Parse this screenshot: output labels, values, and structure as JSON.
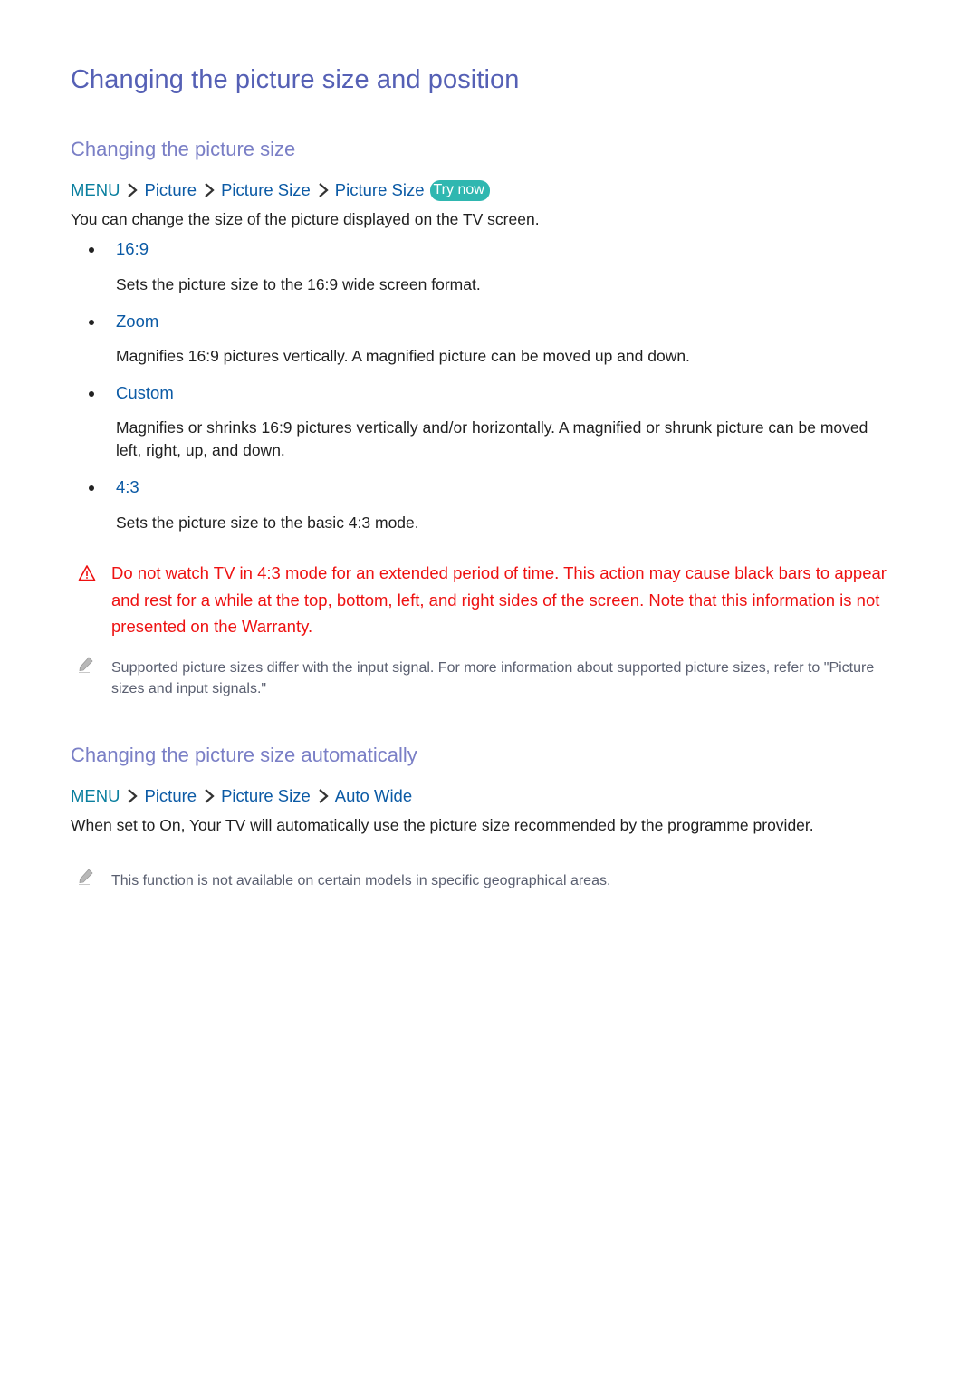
{
  "title": "Changing the picture size and position",
  "section1": {
    "heading": "Changing the picture size",
    "breadcrumb": {
      "menu": "MENU",
      "items": [
        "Picture",
        "Picture Size",
        "Picture Size"
      ],
      "try_now": "Try now"
    },
    "intro": "You can change the size of the picture displayed on the TV screen.",
    "options": [
      {
        "label": "16:9",
        "description": "Sets the picture size to the 16:9 wide screen format."
      },
      {
        "label": "Zoom",
        "description": "Magnifies 16:9 pictures vertically. A magnified picture can be moved up and down."
      },
      {
        "label": "Custom",
        "description": "Magnifies or shrinks 16:9 pictures vertically and/or horizontally. A magnified or shrunk picture can be moved left, right, up, and down."
      },
      {
        "label": "4:3",
        "description": "Sets the picture size to the basic 4:3 mode."
      }
    ],
    "warning": {
      "icon": "warning-triangle-icon",
      "text": "Do not watch TV in 4:3 mode for an extended period of time. This action may cause black bars to appear and rest for a while at the top, bottom, left, and right sides of the screen. Note that this information is not presented on the Warranty."
    },
    "note": {
      "icon": "pencil-note-icon",
      "text": "Supported picture sizes differ with the input signal. For more information about supported picture sizes, refer to \"Picture sizes and input signals.\""
    }
  },
  "section2": {
    "heading": "Changing the picture size automatically",
    "breadcrumb": {
      "menu": "MENU",
      "items": [
        "Picture",
        "Picture Size",
        "Auto Wide"
      ]
    },
    "body": "When set to On, Your TV will automatically use the picture size recommended by the programme provider.",
    "note": {
      "icon": "pencil-note-icon",
      "text": "This function is not available on certain models in specific geographical areas."
    }
  },
  "colors": {
    "title": "#5560b5",
    "subheading": "#7a7fc6",
    "menu": "#0a7f9f",
    "link": "#0b5aa5",
    "warning": "#ee1111",
    "note": "#5a5f70",
    "try_now_bg": "#2fb7b0"
  }
}
